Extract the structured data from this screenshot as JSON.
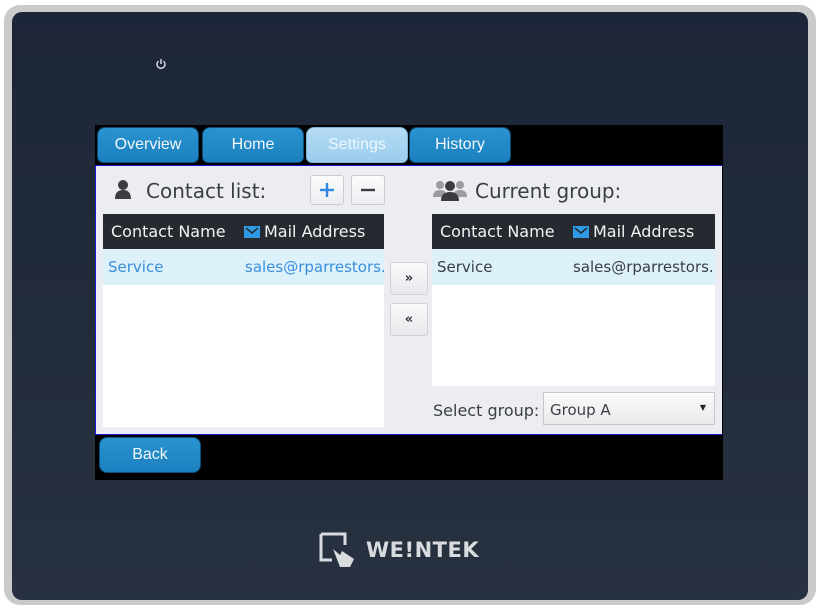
{
  "tabs": [
    {
      "label": "Overview",
      "active": false
    },
    {
      "label": "Home",
      "active": false
    },
    {
      "label": "Settings",
      "active": true
    },
    {
      "label": "History",
      "active": false
    }
  ],
  "contact_list": {
    "title": "Contact list:",
    "add_icon": "plus-icon",
    "remove_icon": "minus-icon",
    "columns": [
      "Contact Name",
      "Mail Address"
    ],
    "rows": [
      {
        "name": "Service",
        "mail": "sales@rparrestors."
      }
    ]
  },
  "move_buttons": {
    "right": "»",
    "left": "«"
  },
  "current_group": {
    "title": "Current group:",
    "columns": [
      "Contact Name",
      "Mail Address"
    ],
    "rows": [
      {
        "name": "Service",
        "mail": "sales@rparrestors."
      }
    ]
  },
  "select_group": {
    "label": "Select group:",
    "value": "Group A"
  },
  "back_label": "Back",
  "brand": "WE!NTEK",
  "colors": {
    "tab": "#1b80bf",
    "tab_active": "#9acdee",
    "link_blue": "#3a8fdc",
    "header_dark": "#26292f",
    "row_highlight": "#ddf1fb"
  }
}
